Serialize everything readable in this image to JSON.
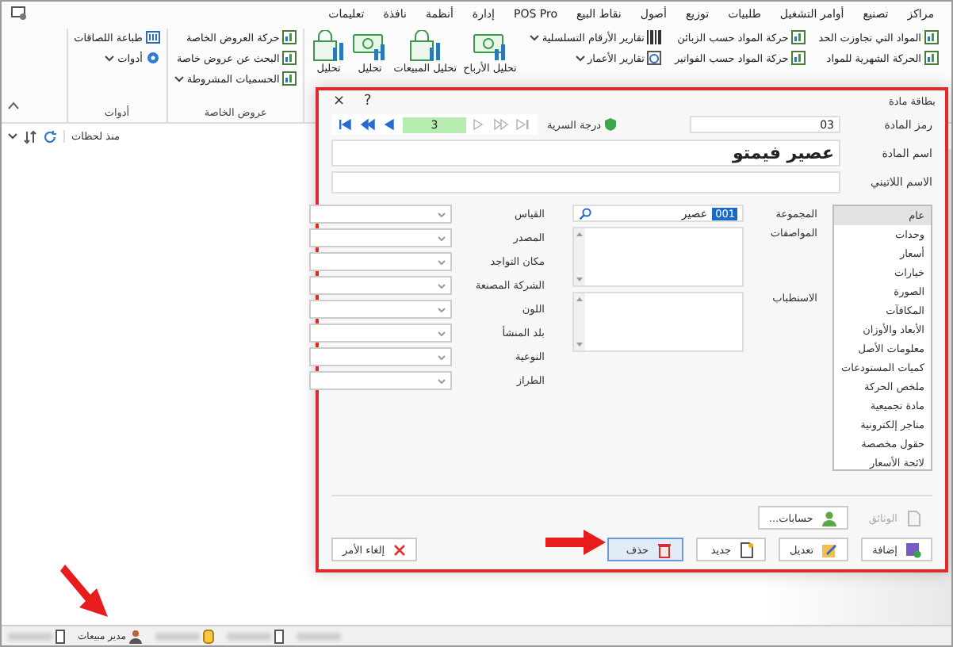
{
  "menu": [
    "مراكز",
    "تصنيع",
    "أوامر التشغيل",
    "طلبيات",
    "توزيع",
    "أصول",
    "نقاط البيع",
    "POS Pro",
    "إدارة",
    "أنظمة",
    "نافذة",
    "تعليمات"
  ],
  "ribbon": {
    "groups": [
      {
        "columns": [
          {
            "kind": "small",
            "items": [
              {
                "label": "المواد التي تجاوزت الحد",
                "dropdown": false
              },
              {
                "label": "الحركة الشهرية للمواد",
                "dropdown": false
              }
            ]
          },
          {
            "kind": "small",
            "items": [
              {
                "label": "حركة المواد حسب الزبائن",
                "dropdown": false
              },
              {
                "label": "حركة المواد حسب الفواتير",
                "dropdown": false
              }
            ]
          },
          {
            "kind": "small",
            "items": [
              {
                "label": "تقارير الأرقام التسلسلية",
                "dropdown": true
              },
              {
                "label": "تقارير الأعمار",
                "dropdown": true
              }
            ]
          },
          {
            "kind": "large",
            "items": [
              {
                "label": "تحليل الأرباح"
              },
              {
                "label": "تحليل المبيعات"
              },
              {
                "label": "تحليل"
              },
              {
                "label": "تحليل"
              }
            ]
          }
        ]
      },
      {
        "label": "عروض الخاصة",
        "columns": [
          {
            "kind": "small",
            "items": [
              {
                "label": "حركة العروض الخاصة",
                "dropdown": false
              },
              {
                "label": "البحث عن عروض خاصة",
                "dropdown": false
              },
              {
                "label": "الحسميات المشروطة",
                "dropdown": true
              }
            ]
          }
        ]
      },
      {
        "label": "أدوات",
        "columns": [
          {
            "kind": "small",
            "items": [
              {
                "label": "طباعة اللصاقات",
                "dropdown": false
              },
              {
                "label": "أدوات",
                "dropdown": true
              }
            ]
          }
        ]
      }
    ]
  },
  "refresh_bar": {
    "text": "منذ لحظات"
  },
  "dialog": {
    "title": "بطاقة مادة",
    "help": "?",
    "close": "×",
    "highlighted": true,
    "code": {
      "label": "رمز المادة",
      "value": "03"
    },
    "secrecy": {
      "label": "درجة السرية"
    },
    "navigator": {
      "record": "3",
      "buttons": [
        {
          "kind": "first",
          "disabled": false
        },
        {
          "kind": "previous_page",
          "disabled": false
        },
        {
          "kind": "previous",
          "disabled": false
        },
        {
          "kind": "next",
          "disabled": true
        },
        {
          "kind": "next_page",
          "disabled": true
        },
        {
          "kind": "last",
          "disabled": true
        }
      ]
    },
    "name": {
      "label": "اسم المادة",
      "value": "عصير فيمتو"
    },
    "latin_name": {
      "label": "الاسم اللاتيني"
    },
    "sections": [
      {
        "label": "عام",
        "selected": true
      },
      {
        "label": "وحدات",
        "selected": false
      },
      {
        "label": "أسعار",
        "selected": false
      },
      {
        "label": "خيارات",
        "selected": false
      },
      {
        "label": "الصورة",
        "selected": false
      },
      {
        "label": "المكافآت",
        "selected": false
      },
      {
        "label": "الأبعاد والأوزان",
        "selected": false
      },
      {
        "label": "معلومات الأصل",
        "selected": false
      },
      {
        "label": "كميات المستودعات",
        "selected": false
      },
      {
        "label": "ملخص الحركة",
        "selected": false
      },
      {
        "label": "مادة تجميعية",
        "selected": false
      },
      {
        "label": "متاجر إلكترونية",
        "selected": false
      },
      {
        "label": "حقول مخصصة",
        "selected": false
      },
      {
        "label": "لائحة الأسعار",
        "selected": false
      }
    ],
    "group": {
      "label": "المجموعة",
      "code": "001",
      "value": "عصير"
    },
    "specs": {
      "label": "المواصفات"
    },
    "indication": {
      "label": "الاستطباب"
    },
    "properties": [
      {
        "label": "القياس"
      },
      {
        "label": "المصدر"
      },
      {
        "label": "مكان التواجد"
      },
      {
        "label": "الشركة المصنعة"
      },
      {
        "label": "اللون"
      },
      {
        "label": "بلد المنشأ"
      },
      {
        "label": "النوعية"
      },
      {
        "label": "الطراز"
      }
    ],
    "links": [
      {
        "label": "الوثائق",
        "kind": "documents",
        "disabled": true
      },
      {
        "label": "حسابات...",
        "kind": "accounts",
        "disabled": false
      }
    ],
    "actions": [
      {
        "label": "إضافة",
        "kind": "add",
        "focused": false
      },
      {
        "label": "تعديل",
        "kind": "edit",
        "focused": false
      },
      {
        "label": "جديد",
        "kind": "new",
        "focused": false
      },
      {
        "label": "حذف",
        "kind": "delete",
        "focused": true
      }
    ],
    "cancel": {
      "label": "إلغاء الأمر"
    }
  },
  "status_bar": {
    "items": [
      {
        "kind": "terminal"
      },
      {
        "kind": "user",
        "text": "مدير مبيعات"
      },
      {
        "kind": "database"
      },
      {
        "kind": "device"
      },
      {
        "kind": "date"
      }
    ]
  },
  "annotations": [
    {
      "kind": "arrow"
    },
    {
      "kind": "arrow"
    }
  ]
}
